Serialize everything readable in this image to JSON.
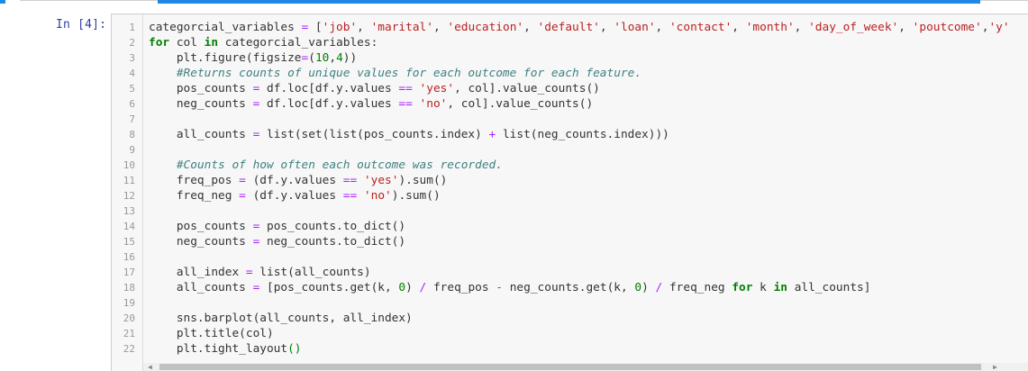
{
  "cell": {
    "prompt": "In [4]:",
    "line_numbers": [
      "1",
      "2",
      "3",
      "4",
      "5",
      "6",
      "7",
      "8",
      "9",
      "10",
      "11",
      "12",
      "13",
      "14",
      "15",
      "16",
      "17",
      "18",
      "19",
      "20",
      "21",
      "22"
    ],
    "code_lines": [
      [
        [
          "t",
          "categorcial_variables "
        ],
        [
          "o",
          "="
        ],
        [
          "t",
          " ["
        ],
        [
          "s",
          "'job'"
        ],
        [
          "t",
          ", "
        ],
        [
          "s",
          "'marital'"
        ],
        [
          "t",
          ", "
        ],
        [
          "s",
          "'education'"
        ],
        [
          "t",
          ", "
        ],
        [
          "s",
          "'default'"
        ],
        [
          "t",
          ", "
        ],
        [
          "s",
          "'loan'"
        ],
        [
          "t",
          ", "
        ],
        [
          "s",
          "'contact'"
        ],
        [
          "t",
          ", "
        ],
        [
          "s",
          "'month'"
        ],
        [
          "t",
          ", "
        ],
        [
          "s",
          "'day_of_week'"
        ],
        [
          "t",
          ", "
        ],
        [
          "s",
          "'poutcome'"
        ],
        [
          "t",
          ","
        ],
        [
          "s",
          "'y'"
        ]
      ],
      [
        [
          "k",
          "for"
        ],
        [
          "t",
          " col "
        ],
        [
          "k",
          "in"
        ],
        [
          "t",
          " categorcial_variables:"
        ]
      ],
      [
        [
          "t",
          "    plt.figure(figsize"
        ],
        [
          "o",
          "="
        ],
        [
          "t",
          "("
        ],
        [
          "n",
          "10"
        ],
        [
          "t",
          ","
        ],
        [
          "n",
          "4"
        ],
        [
          "t",
          "))"
        ]
      ],
      [
        [
          "t",
          "    "
        ],
        [
          "c",
          "#Returns counts of unique values for each outcome for each feature."
        ]
      ],
      [
        [
          "t",
          "    pos_counts "
        ],
        [
          "o",
          "="
        ],
        [
          "t",
          " df.loc[df.y.values "
        ],
        [
          "o",
          "=="
        ],
        [
          "t",
          " "
        ],
        [
          "s",
          "'yes'"
        ],
        [
          "t",
          ", col].value_counts()"
        ]
      ],
      [
        [
          "t",
          "    neg_counts "
        ],
        [
          "o",
          "="
        ],
        [
          "t",
          " df.loc[df.y.values "
        ],
        [
          "o",
          "=="
        ],
        [
          "t",
          " "
        ],
        [
          "s",
          "'no'"
        ],
        [
          "t",
          ", col].value_counts()"
        ]
      ],
      [
        [
          "t",
          ""
        ]
      ],
      [
        [
          "t",
          "    all_counts "
        ],
        [
          "o",
          "="
        ],
        [
          "t",
          " list(set(list(pos_counts.index) "
        ],
        [
          "o",
          "+"
        ],
        [
          "t",
          " list(neg_counts.index)))"
        ]
      ],
      [
        [
          "t",
          ""
        ]
      ],
      [
        [
          "t",
          "    "
        ],
        [
          "c",
          "#Counts of how often each outcome was recorded."
        ]
      ],
      [
        [
          "t",
          "    freq_pos "
        ],
        [
          "o",
          "="
        ],
        [
          "t",
          " (df.y.values "
        ],
        [
          "o",
          "=="
        ],
        [
          "t",
          " "
        ],
        [
          "s",
          "'yes'"
        ],
        [
          "t",
          ").sum()"
        ]
      ],
      [
        [
          "t",
          "    freq_neg "
        ],
        [
          "o",
          "="
        ],
        [
          "t",
          " (df.y.values "
        ],
        [
          "o",
          "=="
        ],
        [
          "t",
          " "
        ],
        [
          "s",
          "'no'"
        ],
        [
          "t",
          ").sum()"
        ]
      ],
      [
        [
          "t",
          ""
        ]
      ],
      [
        [
          "t",
          "    pos_counts "
        ],
        [
          "o",
          "="
        ],
        [
          "t",
          " pos_counts.to_dict()"
        ]
      ],
      [
        [
          "t",
          "    neg_counts "
        ],
        [
          "o",
          "="
        ],
        [
          "t",
          " neg_counts.to_dict()"
        ]
      ],
      [
        [
          "t",
          ""
        ]
      ],
      [
        [
          "t",
          "    all_index "
        ],
        [
          "o",
          "="
        ],
        [
          "t",
          " list(all_counts)"
        ]
      ],
      [
        [
          "t",
          "    all_counts "
        ],
        [
          "o",
          "="
        ],
        [
          "t",
          " [pos_counts.get(k, "
        ],
        [
          "n",
          "0"
        ],
        [
          "t",
          ") "
        ],
        [
          "o",
          "/"
        ],
        [
          "t",
          " freq_pos "
        ],
        [
          "o",
          "-"
        ],
        [
          "t",
          " neg_counts.get(k, "
        ],
        [
          "n",
          "0"
        ],
        [
          "t",
          ") "
        ],
        [
          "o",
          "/"
        ],
        [
          "t",
          " freq_neg "
        ],
        [
          "k",
          "for"
        ],
        [
          "t",
          " k "
        ],
        [
          "k",
          "in"
        ],
        [
          "t",
          " all_counts]"
        ]
      ],
      [
        [
          "t",
          ""
        ]
      ],
      [
        [
          "t",
          "    sns.barplot(all_counts, all_index)"
        ]
      ],
      [
        [
          "t",
          "    plt.title(col)"
        ]
      ],
      [
        [
          "t",
          "    plt.tight_layout"
        ],
        [
          "n",
          "()"
        ]
      ]
    ]
  },
  "colors": {
    "accent": "#1e88e5",
    "prompt": "#303f9f",
    "keyword": "#008000",
    "string": "#ba2121",
    "number": "#008000",
    "operator": "#aa22ff",
    "comment": "#408080"
  }
}
